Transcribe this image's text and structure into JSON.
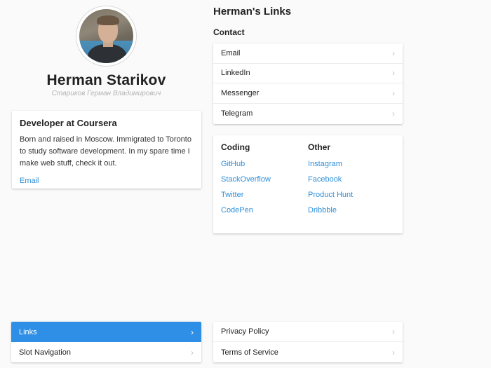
{
  "profile": {
    "name": "Herman Starikov",
    "alt_name": "Стариков Герман Владимирович",
    "avatar_icon": "profile-photo"
  },
  "bio": {
    "title": "Developer at Coursera",
    "text": "Born and raised in Moscow. Immigrated to Toronto to study software development. In my spare time I make web stuff, check it out.",
    "email_link": "Email"
  },
  "links_page": {
    "title": "Herman's Links",
    "contact_heading": "Contact",
    "contact": [
      "Email",
      "LinkedIn",
      "Messenger",
      "Telegram"
    ],
    "coding_heading": "Coding",
    "coding": [
      "GitHub",
      "StackOverflow",
      "Twitter",
      "CodePen"
    ],
    "other_heading": "Other",
    "other": [
      "Instagram",
      "Facebook",
      "Product Hunt",
      "Dribbble"
    ]
  },
  "nav": {
    "main": [
      {
        "label": "Links",
        "active": true
      },
      {
        "label": "Slot Navigation",
        "active": false
      }
    ],
    "legal": [
      "Privacy Policy",
      "Terms of Service"
    ],
    "chevron": "›"
  },
  "colors": {
    "accent": "#2f8fe6",
    "link": "#2f8fd8",
    "background": "#fafafa"
  }
}
